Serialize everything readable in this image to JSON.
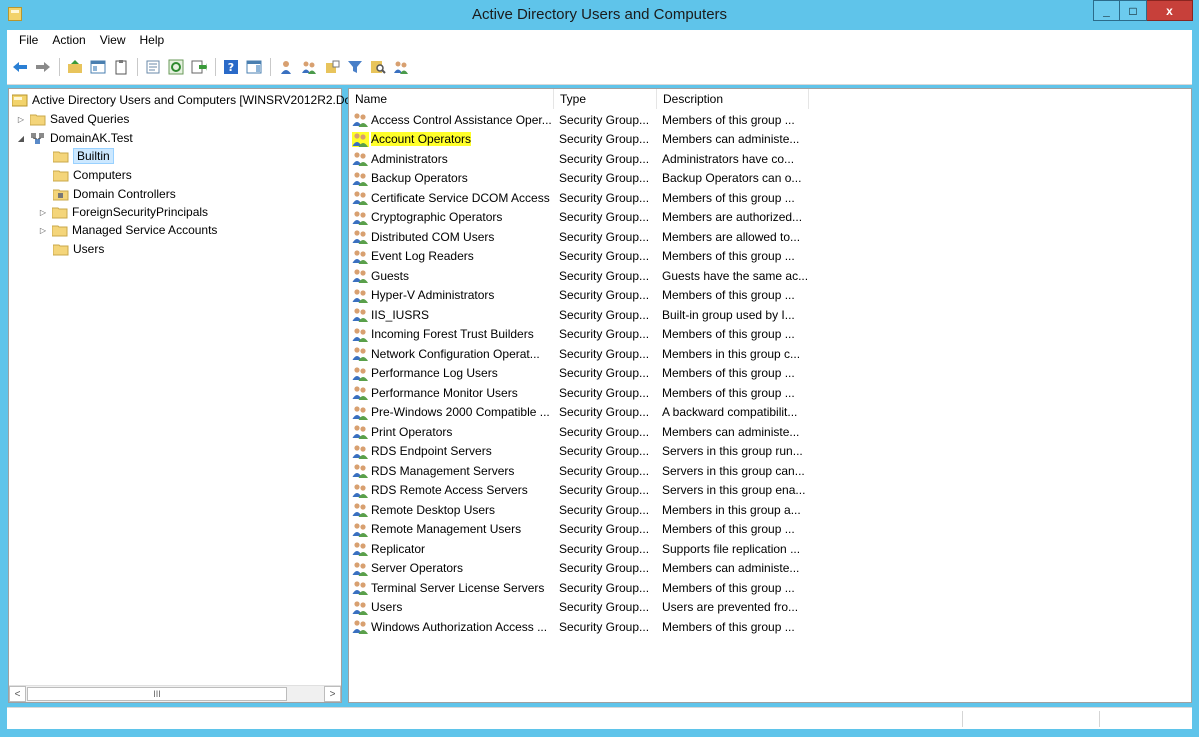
{
  "window": {
    "title": "Active Directory Users and Computers",
    "minimize": "_",
    "maximize": "□",
    "close": "x"
  },
  "menu": [
    "File",
    "Action",
    "View",
    "Help"
  ],
  "tree": {
    "root": "Active Directory Users and Computers [WINSRV2012R2.Do",
    "saved_queries": "Saved Queries",
    "domain": "DomainAK.Test",
    "builtin": "Builtin",
    "computers": "Computers",
    "domain_controllers": "Domain Controllers",
    "foreign": "ForeignSecurityPrincipals",
    "managed": "Managed Service Accounts",
    "users": "Users",
    "scroll_thumb": "III"
  },
  "list": {
    "columns": {
      "name": "Name",
      "type": "Type",
      "description": "Description"
    },
    "rows": [
      {
        "name": "Access Control Assistance Oper...",
        "type": "Security Group...",
        "description": "Members of this group ..."
      },
      {
        "name": "Account Operators",
        "type": "Security Group...",
        "description": "Members can administe..."
      },
      {
        "name": "Administrators",
        "type": "Security Group...",
        "description": "Administrators have co..."
      },
      {
        "name": "Backup Operators",
        "type": "Security Group...",
        "description": "Backup Operators can o..."
      },
      {
        "name": "Certificate Service DCOM Access",
        "type": "Security Group...",
        "description": "Members of this group ..."
      },
      {
        "name": "Cryptographic Operators",
        "type": "Security Group...",
        "description": "Members are authorized..."
      },
      {
        "name": "Distributed COM Users",
        "type": "Security Group...",
        "description": "Members are allowed to..."
      },
      {
        "name": "Event Log Readers",
        "type": "Security Group...",
        "description": "Members of this group ..."
      },
      {
        "name": "Guests",
        "type": "Security Group...",
        "description": "Guests have the same ac..."
      },
      {
        "name": "Hyper-V Administrators",
        "type": "Security Group...",
        "description": "Members of this group ..."
      },
      {
        "name": "IIS_IUSRS",
        "type": "Security Group...",
        "description": "Built-in group used by I..."
      },
      {
        "name": "Incoming Forest Trust Builders",
        "type": "Security Group...",
        "description": "Members of this group ..."
      },
      {
        "name": "Network Configuration Operat...",
        "type": "Security Group...",
        "description": "Members in this group c..."
      },
      {
        "name": "Performance Log Users",
        "type": "Security Group...",
        "description": "Members of this group ..."
      },
      {
        "name": "Performance Monitor Users",
        "type": "Security Group...",
        "description": "Members of this group ..."
      },
      {
        "name": "Pre-Windows 2000 Compatible ...",
        "type": "Security Group...",
        "description": "A backward compatibilit..."
      },
      {
        "name": "Print Operators",
        "type": "Security Group...",
        "description": "Members can administe..."
      },
      {
        "name": "RDS Endpoint Servers",
        "type": "Security Group...",
        "description": "Servers in this group run..."
      },
      {
        "name": "RDS Management Servers",
        "type": "Security Group...",
        "description": "Servers in this group can..."
      },
      {
        "name": "RDS Remote Access Servers",
        "type": "Security Group...",
        "description": "Servers in this group ena..."
      },
      {
        "name": "Remote Desktop Users",
        "type": "Security Group...",
        "description": "Members in this group a..."
      },
      {
        "name": "Remote Management Users",
        "type": "Security Group...",
        "description": "Members of this group ..."
      },
      {
        "name": "Replicator",
        "type": "Security Group...",
        "description": "Supports file replication ..."
      },
      {
        "name": "Server Operators",
        "type": "Security Group...",
        "description": "Members can administe..."
      },
      {
        "name": "Terminal Server License Servers",
        "type": "Security Group...",
        "description": "Members of this group ..."
      },
      {
        "name": "Users",
        "type": "Security Group...",
        "description": "Users are prevented fro..."
      },
      {
        "name": "Windows Authorization Access ...",
        "type": "Security Group...",
        "description": "Members of this group ..."
      }
    ]
  },
  "toolbar_icons": [
    "back-arrow-icon",
    "forward-arrow-icon",
    "up-folder-icon",
    "show-console-tree-icon",
    "clipboard-icon",
    "properties-icon",
    "refresh-icon",
    "export-list-icon",
    "help-icon",
    "action-pane-icon",
    "new-user-icon",
    "new-group-icon",
    "new-ou-icon",
    "filter-icon",
    "find-icon",
    "add-to-group-icon"
  ],
  "colors": {
    "chrome": "#5fc4ea",
    "selection_highlight": "#ffff2a",
    "tree_selection": "#cce8ff"
  }
}
